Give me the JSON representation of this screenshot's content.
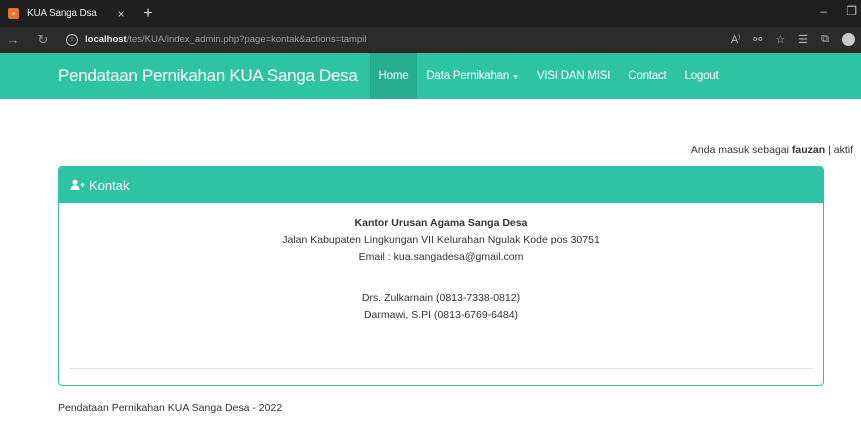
{
  "browser": {
    "tab_title": "KUA Sanga Dsa",
    "tab_close": "×",
    "new_tab": "+",
    "url_host": "localhost",
    "url_path": "/tes/KUA/index_admin.php?page=kontak&actions=tampil",
    "toolbar_icons": [
      "read-aloud-icon",
      "extensions-icon",
      "favorite-add-icon",
      "favorites-icon",
      "collections-icon",
      "profile-icon"
    ]
  },
  "navbar": {
    "brand": "Pendataan Pernikahan KUA Sanga Desa",
    "links": [
      {
        "label": "Home",
        "active": true
      },
      {
        "label": "Data Pernikahan",
        "dropdown": true
      },
      {
        "label": "VISI DAN MISI"
      },
      {
        "label": "Contact"
      },
      {
        "label": "Logout"
      }
    ],
    "color": "#2ec4a3"
  },
  "status": {
    "prefix": "Anda masuk sebagai",
    "user": "fauzan",
    "separator": "|",
    "state": "aktif"
  },
  "panel": {
    "title": "Kontak",
    "org": "Kantor Urusan Agama Sanga Desa",
    "address": "Jalan Kabupaten Lingkungan VII Kelurahan Ngulak Kode pos 30751",
    "email": "Email : kua.sangadesa@gmail.com",
    "contacts": [
      "Drs. Zulkarnain (0813-7338-0812)",
      "Darmawi, S.PI (0813-6769-6484)"
    ]
  },
  "footer": {
    "text": "Pendataan Pernikahan KUA Sanga Desa - 2022"
  }
}
